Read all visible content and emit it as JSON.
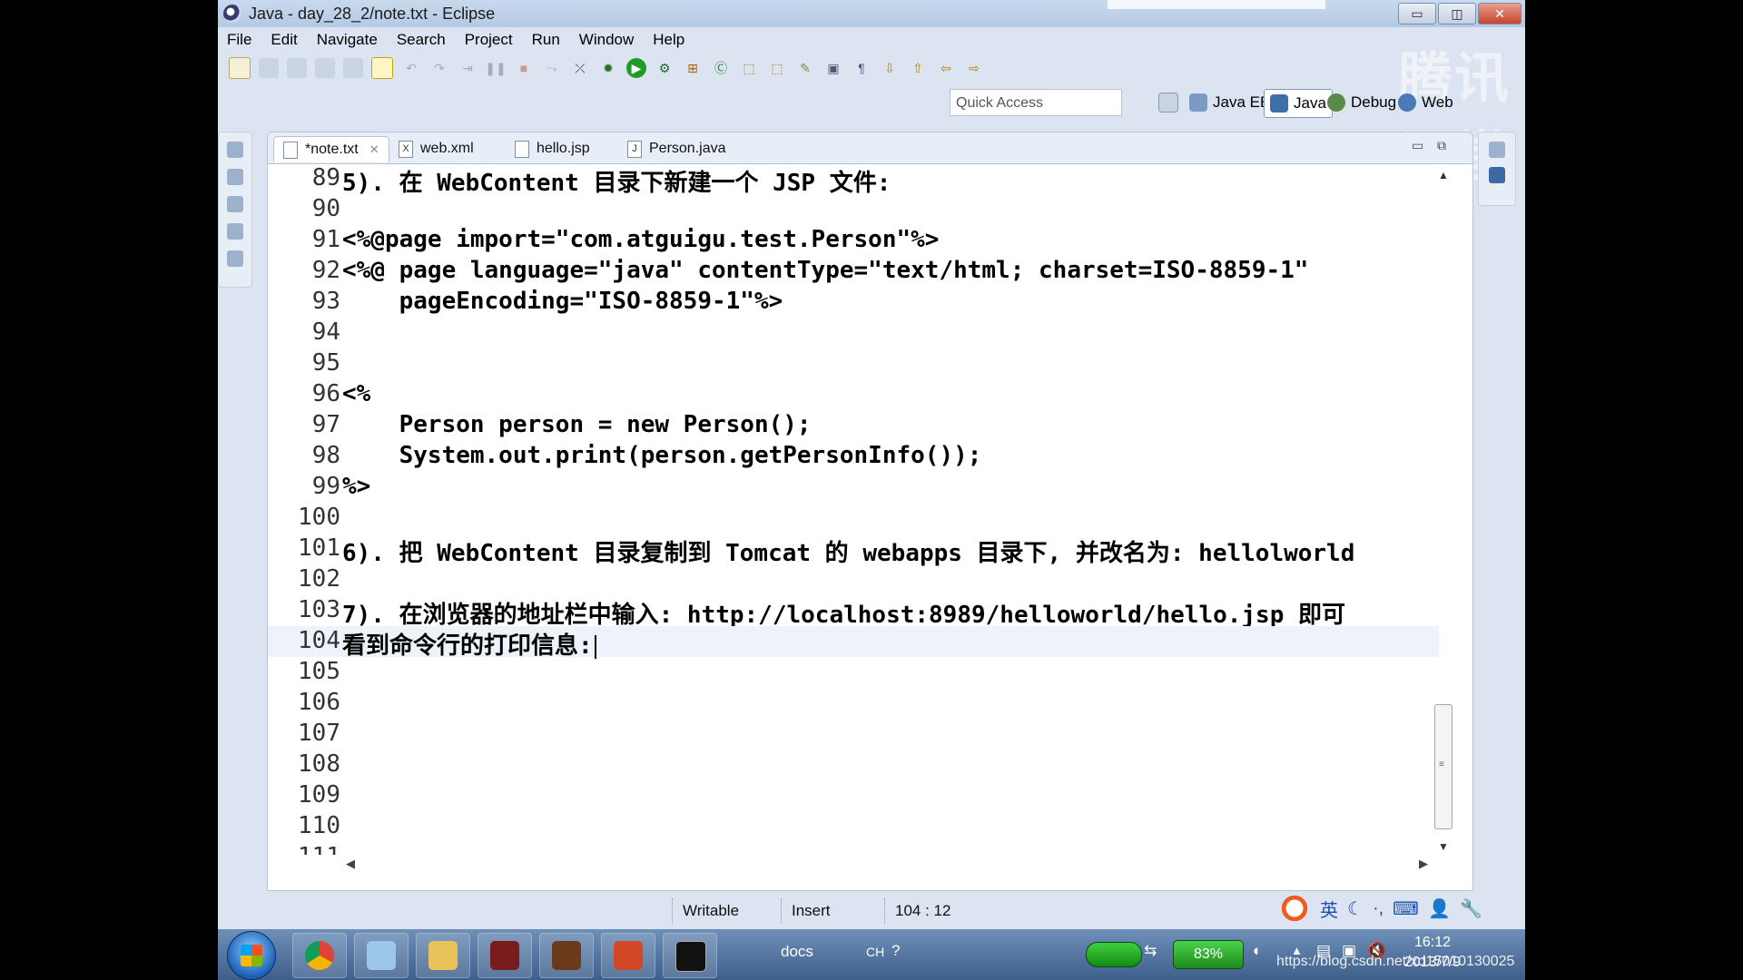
{
  "window": {
    "title": "Java - day_28_2/note.txt - Eclipse",
    "buttons": {
      "minimize": "▭",
      "maximize": "◫",
      "close": "✕"
    }
  },
  "menu": [
    "File",
    "Edit",
    "Navigate",
    "Search",
    "Project",
    "Run",
    "Window",
    "Help"
  ],
  "watermark": "腾讯课堂",
  "quick_access": {
    "placeholder": "Quick Access"
  },
  "perspectives": [
    {
      "label": "Java EE",
      "icon": "java-ee-perspective-icon",
      "active": false
    },
    {
      "label": "Java",
      "icon": "java-perspective-icon",
      "active": true
    },
    {
      "label": "Debug",
      "icon": "debug-perspective-icon",
      "active": false
    },
    {
      "label": "Web",
      "icon": "web-perspective-icon",
      "active": false
    }
  ],
  "tabs": [
    {
      "label": "*note.txt",
      "icon": "text-file-icon",
      "active": true
    },
    {
      "label": "web.xml",
      "icon": "xml-file-icon",
      "active": false
    },
    {
      "label": "hello.jsp",
      "icon": "jsp-file-icon",
      "active": false
    },
    {
      "label": "Person.java",
      "icon": "java-file-icon",
      "active": false
    }
  ],
  "editor": {
    "cursor_line": 104,
    "lines": [
      {
        "n": "89",
        "text": "5). 在 WebContent 目录下新建一个 JSP 文件:"
      },
      {
        "n": "90",
        "text": ""
      },
      {
        "n": "91",
        "text": "<%@page import=\"com.atguigu.test.Person\"%>"
      },
      {
        "n": "92",
        "text": "<%@ page language=\"java\" contentType=\"text/html; charset=ISO-8859-1\""
      },
      {
        "n": "93",
        "text": "    pageEncoding=\"ISO-8859-1\"%>"
      },
      {
        "n": "94",
        "text": ""
      },
      {
        "n": "95",
        "text": ""
      },
      {
        "n": "96",
        "text": "<%"
      },
      {
        "n": "97",
        "text": "    Person person = new Person();"
      },
      {
        "n": "98",
        "text": "    System.out.print(person.getPersonInfo());"
      },
      {
        "n": "99",
        "text": "%>"
      },
      {
        "n": "100",
        "text": ""
      },
      {
        "n": "101",
        "text": "6). 把 WebContent 目录复制到 Tomcat 的 webapps 目录下, 并改名为: hellolworld"
      },
      {
        "n": "102",
        "text": ""
      },
      {
        "n": "103",
        "text": "7). 在浏览器的地址栏中输入: http://localhost:8989/helloworld/hello.jsp 即可"
      },
      {
        "n": "104",
        "text": "看到命令行的打印信息:"
      },
      {
        "n": "105",
        "text": ""
      },
      {
        "n": "106",
        "text": ""
      },
      {
        "n": "107",
        "text": ""
      },
      {
        "n": "108",
        "text": ""
      },
      {
        "n": "109",
        "text": ""
      },
      {
        "n": "110",
        "text": ""
      },
      {
        "n": "111",
        "text": ""
      }
    ]
  },
  "status": {
    "writable": "Writable",
    "mode": "Insert",
    "position": "104 : 12"
  },
  "ime": {
    "lang": "英"
  },
  "taskbar": {
    "apps": [
      "chrome-icon",
      "computer-icon",
      "folder-icon",
      "utility-icon",
      "game-icon",
      "powerpoint-icon",
      "cmd-icon"
    ],
    "docs_label": "docs",
    "ch_label": "CH",
    "battery": "83%",
    "time": "16:12",
    "date": "2013/7/9"
  },
  "source_watermark": "https://blog.csdn.net/xd15010130025"
}
